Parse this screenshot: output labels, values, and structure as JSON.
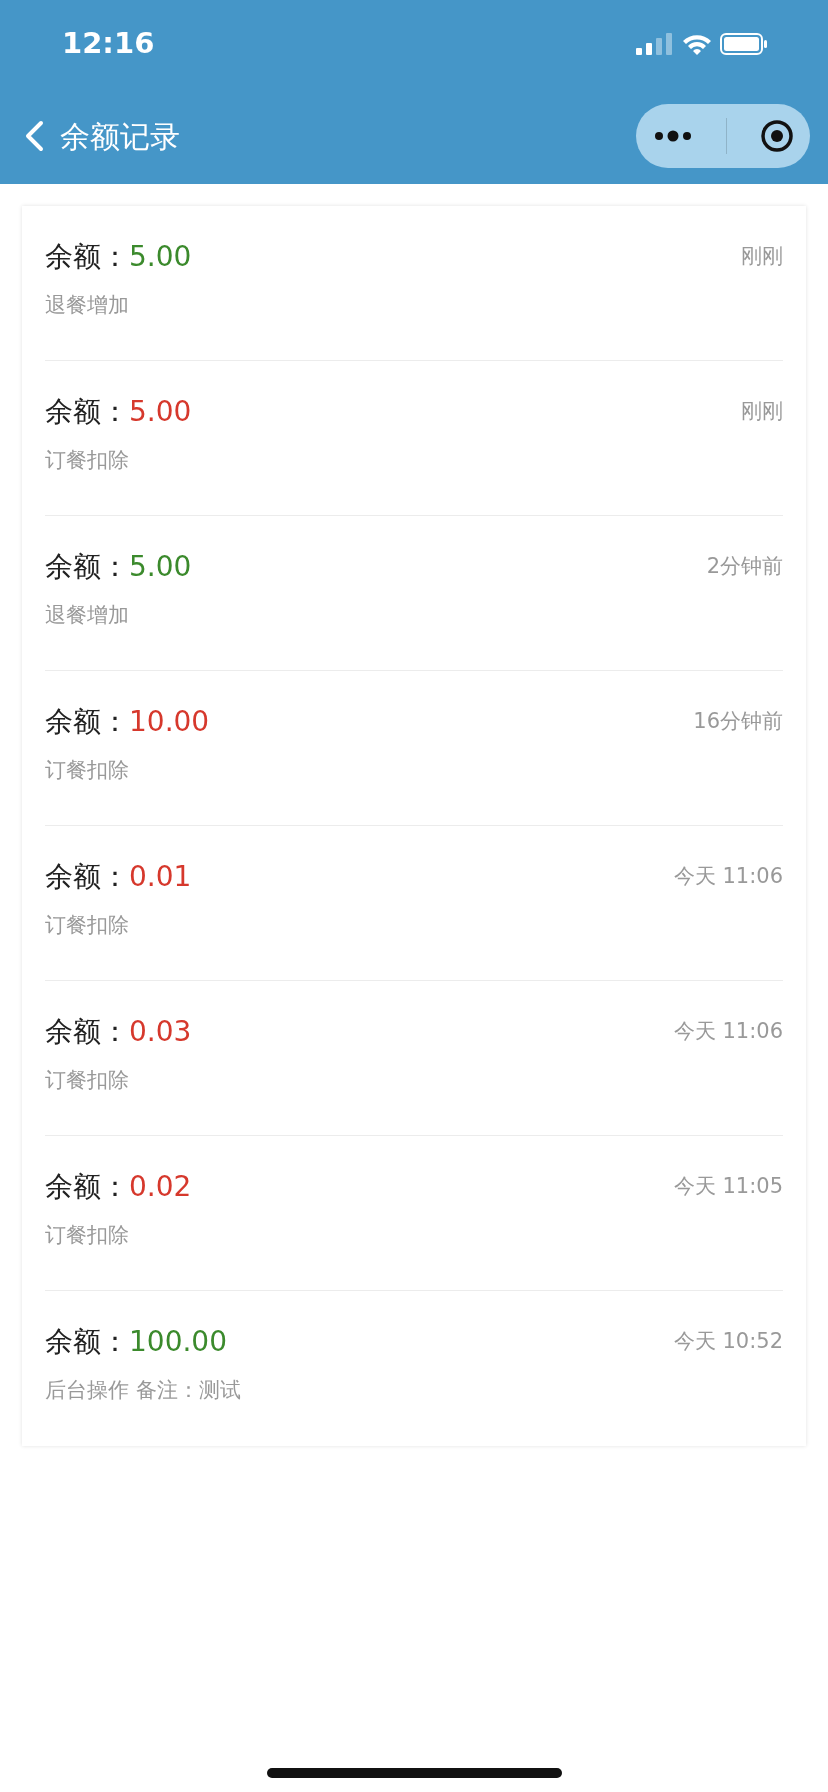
{
  "status_bar": {
    "time": "12:16"
  },
  "nav": {
    "title": "余额记录"
  },
  "records": [
    {
      "label": "余额：",
      "amount": "5.00",
      "color": "#3b8a2c",
      "time": "刚刚",
      "note": "退餐增加"
    },
    {
      "label": "余额：",
      "amount": "5.00",
      "color": "#d6382c",
      "time": "刚刚",
      "note": "订餐扣除"
    },
    {
      "label": "余额：",
      "amount": "5.00",
      "color": "#3b8a2c",
      "time": "2分钟前",
      "note": "退餐增加"
    },
    {
      "label": "余额：",
      "amount": "10.00",
      "color": "#d6382c",
      "time": "16分钟前",
      "note": "订餐扣除"
    },
    {
      "label": "余额：",
      "amount": "0.01",
      "color": "#d6382c",
      "time": "今天 11:06",
      "note": "订餐扣除"
    },
    {
      "label": "余额：",
      "amount": "0.03",
      "color": "#d6382c",
      "time": "今天 11:06",
      "note": "订餐扣除"
    },
    {
      "label": "余额：",
      "amount": "0.02",
      "color": "#d6382c",
      "time": "今天 11:05",
      "note": "订餐扣除"
    },
    {
      "label": "余额：",
      "amount": "100.00",
      "color": "#3b8a2c",
      "time": "今天 10:52",
      "note": "后台操作 备注：测试"
    }
  ]
}
